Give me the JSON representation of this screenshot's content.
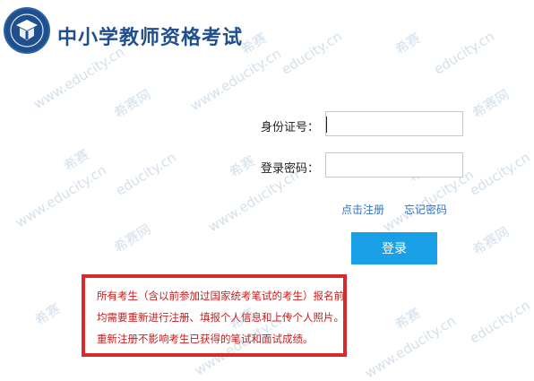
{
  "header": {
    "title": "中小学教师资格考试"
  },
  "watermark": {
    "brand": "希赛",
    "site": "www.educity.cn",
    "domain": "educity.cn",
    "net": "希赛网"
  },
  "form": {
    "id_label": "身份证号：",
    "id_value": "",
    "password_label": "登录密码：",
    "password_value": "",
    "register_link": "点击注册",
    "forgot_link": "忘记密码",
    "login_button": "登录"
  },
  "notice": {
    "line1": "所有考生（含以前参加过国家统考笔试的考生）报名前",
    "line2": "均需要重新进行注册、填报个人信息和上传个人照片。",
    "line3": "重新注册不影响考生已获得的笔试和面试成绩。"
  },
  "colors": {
    "brand_blue": "#1f4f8c",
    "button_blue": "#1aa0e6",
    "link_blue": "#2f72c4",
    "notice_red": "#d92a2a"
  }
}
